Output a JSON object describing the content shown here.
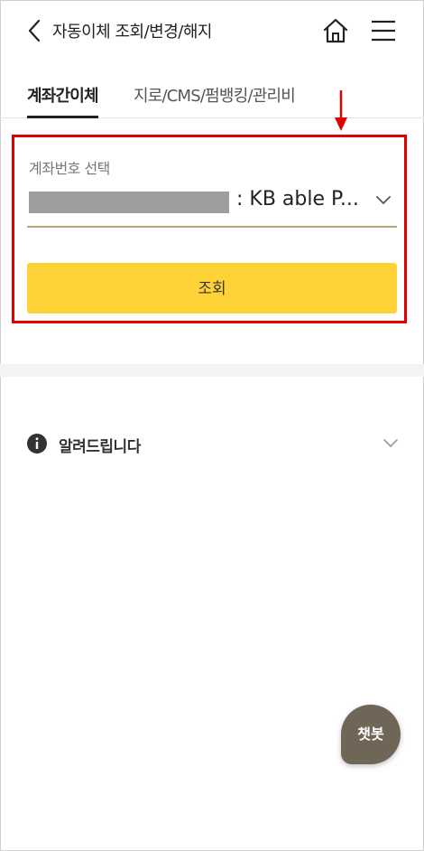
{
  "header": {
    "title": "자동이체 조회/변경/해지",
    "back_icon": "chevron-left-icon",
    "home_icon": "home-icon",
    "menu_icon": "hamburger-menu-icon"
  },
  "tabs": [
    {
      "label": "계좌간이체",
      "active": true
    },
    {
      "label": "지로/CMS/펌뱅킹/관리비",
      "active": false
    }
  ],
  "account": {
    "label": "계좌번호 선택",
    "selected_value": ": KB able P...",
    "masked": true
  },
  "query_button": {
    "label": "조회"
  },
  "notice": {
    "label": "알려드립니다"
  },
  "chatbot": {
    "label": "챗봇"
  },
  "colors": {
    "accent_yellow": "#ffd338",
    "highlight_red": "#e00000",
    "chatbot_bg": "#6f6657",
    "underline_gold": "#b8a57a"
  }
}
